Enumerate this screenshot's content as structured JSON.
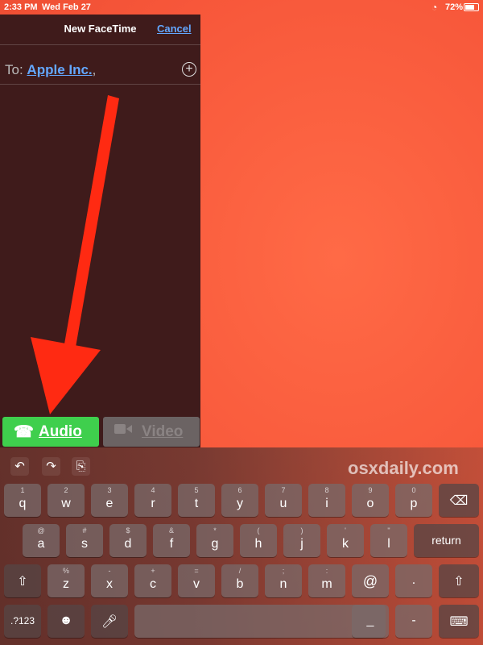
{
  "status_bar": {
    "time": "2:33 PM",
    "date": "Wed Feb 27",
    "battery": "72%"
  },
  "facetime": {
    "title": "New FaceTime",
    "cancel": "Cancel",
    "to_label": "To:",
    "recipient": "Apple Inc.",
    "recipient_suffix": ",",
    "add_icon": "plus-circle-icon",
    "audio_label": "Audio",
    "video_label": "Video"
  },
  "colors": {
    "audio_green": "#3fcf4d",
    "link_blue": "#63a7ff",
    "arrow_red": "#ff2a12"
  },
  "keyboard": {
    "shortcut_icons": [
      "undo-icon",
      "redo-icon",
      "paste-icon"
    ],
    "watermark": "osxdaily.com",
    "row1": [
      {
        "sub": "1",
        "key": "q"
      },
      {
        "sub": "2",
        "key": "w"
      },
      {
        "sub": "3",
        "key": "e"
      },
      {
        "sub": "4",
        "key": "r"
      },
      {
        "sub": "5",
        "key": "t"
      },
      {
        "sub": "6",
        "key": "y"
      },
      {
        "sub": "7",
        "key": "u"
      },
      {
        "sub": "8",
        "key": "i"
      },
      {
        "sub": "9",
        "key": "o"
      },
      {
        "sub": "0",
        "key": "p"
      }
    ],
    "row2": [
      {
        "sub": "@",
        "key": "a"
      },
      {
        "sub": "#",
        "key": "s"
      },
      {
        "sub": "$",
        "key": "d"
      },
      {
        "sub": "&",
        "key": "f"
      },
      {
        "sub": "*",
        "key": "g"
      },
      {
        "sub": "(",
        "key": "h"
      },
      {
        "sub": ")",
        "key": "j"
      },
      {
        "sub": "'",
        "key": "k"
      },
      {
        "sub": "\"",
        "key": "l"
      }
    ],
    "row3": [
      {
        "sub": "%",
        "key": "z"
      },
      {
        "sub": "-",
        "key": "x"
      },
      {
        "sub": "+",
        "key": "c"
      },
      {
        "sub": "=",
        "key": "v"
      },
      {
        "sub": "/",
        "key": "b"
      },
      {
        "sub": ";",
        "key": "n"
      },
      {
        "sub": ":",
        "key": "m"
      },
      {
        "sub": "",
        "key": "@"
      },
      {
        "sub": "",
        "key": "."
      }
    ],
    "return_label": "return",
    "numbers_label": ".?123",
    "underscore": "_",
    "dash": "-"
  }
}
